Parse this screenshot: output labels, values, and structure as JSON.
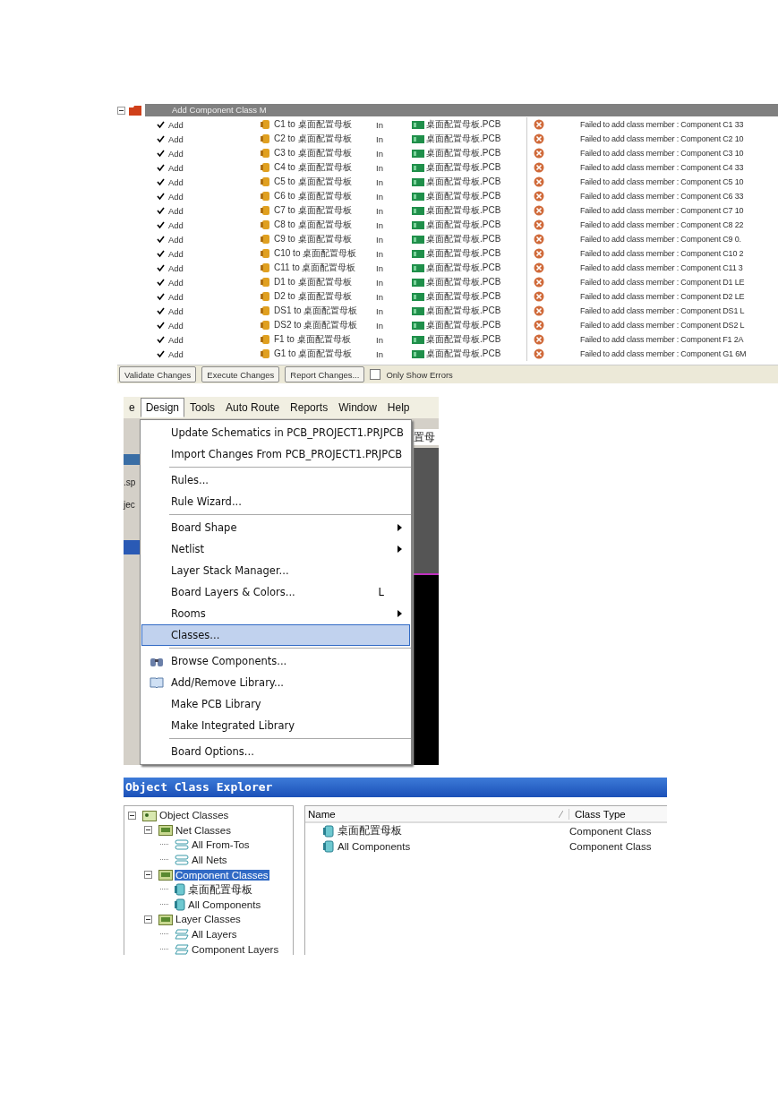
{
  "changes_panel": {
    "group": {
      "title": "Add Component Class M",
      "expanded": true
    },
    "rows": [
      {
        "checked": true,
        "action": "Add",
        "object": "C1 to 桌面配置母板",
        "direction": "In",
        "document": "桌面配置母板.PCB",
        "message": "Failed to add class member : Component C1 33"
      },
      {
        "checked": true,
        "action": "Add",
        "object": "C2 to 桌面配置母板",
        "direction": "In",
        "document": "桌面配置母板.PCB",
        "message": "Failed to add class member : Component C2 10"
      },
      {
        "checked": true,
        "action": "Add",
        "object": "C3 to 桌面配置母板",
        "direction": "In",
        "document": "桌面配置母板.PCB",
        "message": "Failed to add class member : Component C3 10"
      },
      {
        "checked": true,
        "action": "Add",
        "object": "C4 to 桌面配置母板",
        "direction": "In",
        "document": "桌面配置母板.PCB",
        "message": "Failed to add class member : Component C4 33"
      },
      {
        "checked": true,
        "action": "Add",
        "object": "C5 to 桌面配置母板",
        "direction": "In",
        "document": "桌面配置母板.PCB",
        "message": "Failed to add class member : Component C5 10"
      },
      {
        "checked": true,
        "action": "Add",
        "object": "C6 to 桌面配置母板",
        "direction": "In",
        "document": "桌面配置母板.PCB",
        "message": "Failed to add class member : Component C6 33"
      },
      {
        "checked": true,
        "action": "Add",
        "object": "C7 to 桌面配置母板",
        "direction": "In",
        "document": "桌面配置母板.PCB",
        "message": "Failed to add class member : Component C7 10"
      },
      {
        "checked": true,
        "action": "Add",
        "object": "C8 to 桌面配置母板",
        "direction": "In",
        "document": "桌面配置母板.PCB",
        "message": "Failed to add class member : Component C8 22"
      },
      {
        "checked": true,
        "action": "Add",
        "object": "C9 to 桌面配置母板",
        "direction": "In",
        "document": "桌面配置母板.PCB",
        "message": "Failed to add class member : Component C9 0."
      },
      {
        "checked": true,
        "action": "Add",
        "object": "C10 to 桌面配置母板",
        "direction": "In",
        "document": "桌面配置母板.PCB",
        "message": "Failed to add class member : Component C10 2"
      },
      {
        "checked": true,
        "action": "Add",
        "object": "C11 to 桌面配置母板",
        "direction": "In",
        "document": "桌面配置母板.PCB",
        "message": "Failed to add class member : Component C11 3"
      },
      {
        "checked": true,
        "action": "Add",
        "object": "D1 to 桌面配置母板",
        "direction": "In",
        "document": "桌面配置母板.PCB",
        "message": "Failed to add class member : Component D1 LE"
      },
      {
        "checked": true,
        "action": "Add",
        "object": "D2 to 桌面配置母板",
        "direction": "In",
        "document": "桌面配置母板.PCB",
        "message": "Failed to add class member : Component D2 LE"
      },
      {
        "checked": true,
        "action": "Add",
        "object": "DS1 to 桌面配置母板",
        "direction": "In",
        "document": "桌面配置母板.PCB",
        "message": "Failed to add class member : Component DS1 L"
      },
      {
        "checked": true,
        "action": "Add",
        "object": "DS2 to 桌面配置母板",
        "direction": "In",
        "document": "桌面配置母板.PCB",
        "message": "Failed to add class member : Component DS2 L"
      },
      {
        "checked": true,
        "action": "Add",
        "object": "F1 to 桌面配置母板",
        "direction": "In",
        "document": "桌面配置母板.PCB",
        "message": "Failed to add class member : Component F1 2A"
      },
      {
        "checked": true,
        "action": "Add",
        "object": "G1 to 桌面配置母板",
        "direction": "In",
        "document": "桌面配置母板.PCB",
        "message": "Failed to add class member : Component G1 6M"
      }
    ],
    "buttons": [
      "Validate Changes",
      "Execute Changes",
      "Report Changes..."
    ],
    "only_show_errors": {
      "label": "Only Show Errors",
      "checked": false
    }
  },
  "menu_screen": {
    "menubar": [
      {
        "label": "e",
        "selected": false
      },
      {
        "label": "Design",
        "selected": true
      },
      {
        "label": "Tools",
        "selected": false
      },
      {
        "label": "Auto Route",
        "selected": false
      },
      {
        "label": "Reports",
        "selected": false
      },
      {
        "label": "Window",
        "selected": false
      },
      {
        "label": "Help",
        "selected": false
      }
    ],
    "background_text": [
      ".sp",
      "jec"
    ],
    "background_tab": "置母",
    "menu": [
      {
        "kind": "item",
        "label": "Update Schematics in PCB_PROJECT1.PRJPCB",
        "selected": false
      },
      {
        "kind": "item",
        "label": "Import Changes From PCB_PROJECT1.PRJPCB",
        "selected": false
      },
      {
        "kind": "separator"
      },
      {
        "kind": "item",
        "label": "Rules...",
        "selected": false
      },
      {
        "kind": "item",
        "label": "Rule Wizard...",
        "selected": false
      },
      {
        "kind": "separator"
      },
      {
        "kind": "item",
        "label": "Board Shape",
        "submenu": true,
        "selected": false
      },
      {
        "kind": "item",
        "label": "Netlist",
        "submenu": true,
        "selected": false
      },
      {
        "kind": "item",
        "label": "Layer Stack Manager...",
        "selected": false
      },
      {
        "kind": "item",
        "label": "Board Layers & Colors...",
        "shortcut": "L",
        "selected": false
      },
      {
        "kind": "item",
        "label": "Rooms",
        "submenu": true,
        "selected": false
      },
      {
        "kind": "item",
        "label": "Classes...",
        "selected": true
      },
      {
        "kind": "separator"
      },
      {
        "kind": "browse",
        "label": "Browse Components...",
        "selected": false
      },
      {
        "kind": "library",
        "label": "Add/Remove Library...",
        "selected": false
      },
      {
        "kind": "item",
        "label": "Make PCB Library",
        "selected": false
      },
      {
        "kind": "item",
        "label": "Make Integrated Library",
        "selected": false
      },
      {
        "kind": "separator"
      },
      {
        "kind": "item",
        "label": "Board Options...",
        "selected": false
      }
    ]
  },
  "explorer": {
    "title": "Object Class Explorer",
    "tree": [
      {
        "label": "Object Classes",
        "kind": "root",
        "expanded": true,
        "selected": false,
        "children": [
          {
            "label": "Net Classes",
            "kind": "folder",
            "expanded": true,
            "selected": false,
            "children": [
              {
                "label": "All From-Tos",
                "kind": "net",
                "selected": false
              },
              {
                "label": "All Nets",
                "kind": "net",
                "selected": false
              }
            ]
          },
          {
            "label": "Component Classes",
            "kind": "folder",
            "expanded": true,
            "selected": true,
            "children": [
              {
                "label": "桌面配置母板",
                "kind": "component",
                "selected": false
              },
              {
                "label": "All Components",
                "kind": "component",
                "selected": false
              }
            ]
          },
          {
            "label": "Layer Classes",
            "kind": "folder",
            "expanded": true,
            "selected": false,
            "children": [
              {
                "label": "All Layers",
                "kind": "layer",
                "selected": false
              },
              {
                "label": "Component Layers",
                "kind": "layer",
                "selected": false
              }
            ]
          }
        ]
      }
    ],
    "columns": [
      "Name",
      "Class Type"
    ],
    "rows": [
      {
        "name": "桌面配置母板",
        "type": "Component Class"
      },
      {
        "name": "All Components",
        "type": "Component Class"
      }
    ]
  }
}
